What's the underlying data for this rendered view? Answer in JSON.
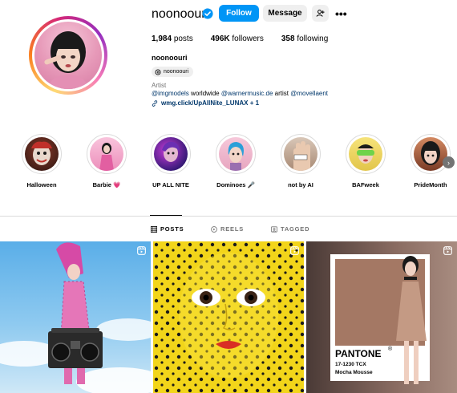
{
  "profile": {
    "username": "noonoouri",
    "follow_label": "Follow",
    "message_label": "Message",
    "stats": {
      "posts_count": "1,984",
      "posts_label": "posts",
      "followers_count": "496K",
      "followers_label": "followers",
      "following_count": "358",
      "following_label": "following"
    },
    "full_name": "noonoouri",
    "threads_handle": "noonoouri",
    "category": "Artist",
    "bio": {
      "mention1": "@imgmodels",
      "text1": " worldwide ",
      "mention2": "@warnermusic.de",
      "text2": " artist ",
      "mention3": "@movellaent"
    },
    "link": "wmg.click/UpAllNite_LUNAX + 1"
  },
  "highlights": [
    {
      "label": "Halloween"
    },
    {
      "label": "Barbie 💗"
    },
    {
      "label": "UP ALL NITE"
    },
    {
      "label": "Dominoes 🎤"
    },
    {
      "label": "not by AI"
    },
    {
      "label": "BAFweek"
    },
    {
      "label": "PrideMonth"
    }
  ],
  "tabs": [
    {
      "label": "POSTS",
      "active": true
    },
    {
      "label": "REELS",
      "active": false
    },
    {
      "label": "TAGGED",
      "active": false
    }
  ],
  "posts": {
    "pantone_brand": "PANTONE",
    "pantone_code": "17-1230 TCX",
    "pantone_name": "Mocha Mousse"
  },
  "colors": {
    "follow_button": "#0095f6",
    "secondary_button": "#efefef",
    "link": "#00376b",
    "verified_badge": "#0095f6"
  },
  "icons": [
    "verified-badge-icon",
    "add-user-icon",
    "more-icon",
    "threads-icon",
    "link-icon",
    "grid-icon",
    "reels-icon",
    "tagged-icon",
    "reel-indicator-icon",
    "chevron-right-icon"
  ]
}
